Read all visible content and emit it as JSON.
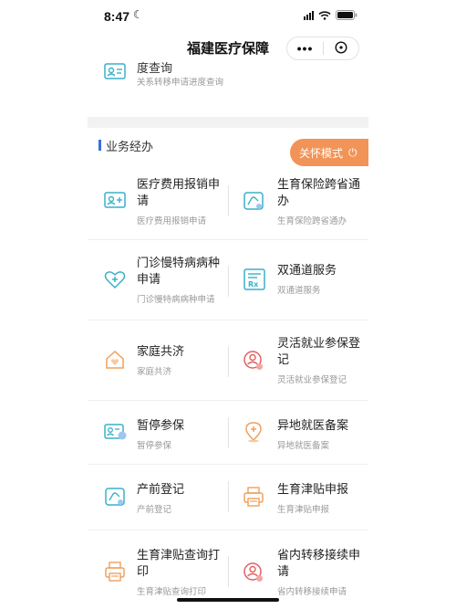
{
  "status_bar": {
    "time": "8:47"
  },
  "nav": {
    "title": "福建医疗保障",
    "more_label": "•••"
  },
  "top_item": {
    "title": "度查询",
    "subtitle": "关系转移申请进度查询"
  },
  "section": {
    "title": "业务经办",
    "care_mode_label": "关怀模式"
  },
  "services": [
    {
      "title": "医疗费用报销申请",
      "subtitle": "医疗费用报销申请",
      "icon": "card-icon",
      "color": "#3ab0c9"
    },
    {
      "title": "生育保险跨省通办",
      "subtitle": "生育保险跨省通办",
      "icon": "hand-card-icon",
      "color": "#3ab0c9"
    },
    {
      "title": "门诊慢特病病种申请",
      "subtitle": "门诊慢特病病种申请",
      "icon": "heart-plus-icon",
      "color": "#3ab0c9"
    },
    {
      "title": "双通道服务",
      "subtitle": "双通道服务",
      "icon": "rx-icon",
      "color": "#3ab0c9"
    },
    {
      "title": "家庭共济",
      "subtitle": "家庭共济",
      "icon": "house-heart-icon",
      "color": "#f0a05c"
    },
    {
      "title": "灵活就业参保登记",
      "subtitle": "灵活就业参保登记",
      "icon": "person-badge-icon",
      "color": "#e06060"
    },
    {
      "title": "暂停参保",
      "subtitle": "暂停参保",
      "icon": "card-pause-icon",
      "color": "#3ab0c9"
    },
    {
      "title": "异地就医备案",
      "subtitle": "异地就医备案",
      "icon": "location-plus-icon",
      "color": "#f0a05c"
    },
    {
      "title": "产前登记",
      "subtitle": "产前登记",
      "icon": "hand-card-icon",
      "color": "#3ab0c9"
    },
    {
      "title": "生育津贴申报",
      "subtitle": "生育津贴申报",
      "icon": "printer-icon",
      "color": "#f0a05c"
    },
    {
      "title": "生育津贴查询打印",
      "subtitle": "生育津贴查询打印",
      "icon": "printer-icon",
      "color": "#f0a05c"
    },
    {
      "title": "省内转移接续申请",
      "subtitle": "省内转移接续申请",
      "icon": "person-badge-icon",
      "color": "#e06060"
    }
  ]
}
